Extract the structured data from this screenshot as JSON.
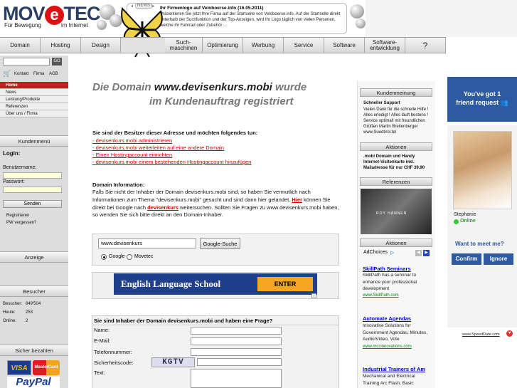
{
  "header": {
    "logo_text_pre": "MOV",
    "logo_text_e": "e",
    "logo_text_post": "TEC",
    "tagline_left": "Für Bewegung",
    "tagline_right": "im Internet",
    "news_label": "NEWS",
    "news_title": "Ihr Firmenlogo auf Veloboerse.info (16.05.2011)",
    "news_body": "Präsentieren Sie jetzt Ihre Firma auf der Startseite von Veloboerse.info. Auf der Startseite direkt unterhalb der Suchfunktion und der Top-Anzeigen. wird Ihr Logo täglich von vielen Personen, welche ihr Fahrrad oder Zubehör ..."
  },
  "nav": {
    "items": [
      "Domain",
      "Hosting",
      "Design",
      "Such-\nmaschinen",
      "Optimierung",
      "Werbung",
      "Service",
      "Software",
      "Software-\nentwicklung",
      "?"
    ]
  },
  "sidebar": {
    "search_button": "GO",
    "links_top": [
      "Kontakt",
      "Firma",
      "AGB"
    ],
    "menu": [
      "Home",
      "News",
      "Leistung/Produkte",
      "Referenzen",
      "Über uns / Firma"
    ],
    "kundenmenu_title": "Kundenmenü",
    "login_label": "Login:",
    "username_label": "Benutzername:",
    "password_label": "Passwort:",
    "send_button": "Senden",
    "register_link": "Registrieren",
    "forgot_link": "PW vergessen?",
    "anzeige_title": "Anzeige",
    "besucher_title": "Besucher",
    "besucher_label": "Besucher:",
    "besucher_value": "849'504",
    "heute_label": "Heute:",
    "heute_value": "253",
    "online_label": "Online:",
    "online_value": "2",
    "payment_title": "Sicher bezahlen",
    "visa": "VISA",
    "mastercard": "MasterCard",
    "paypal": "PayPal"
  },
  "main": {
    "title_pre": "Die Domain ",
    "title_domain": "www.devisenkurs.mobi",
    "title_post": " wurde",
    "title_line2": "im Kundenauftrag registriert",
    "owner_question": "Sie sind der Besitzer dieser Adresse und möchten folgendes tun:",
    "owner_links": [
      "- devisenkurs.mobi administrieren",
      "- devisenkurs.mobi weiterleiten auf eine andere Domain",
      "- Einen Hostingaccount einrichten",
      "- devisenkurs.mobi einem bestehenden Hostingaccount hinzufügen"
    ],
    "info_heading": "Domain Information:",
    "info_line1": "Falls Sie nicht der Inhaber der Domain devisenkurs.mobi sind, so haben Sie vermutlich nach",
    "info_line2": "Informationen zum Thema \"devisenkurs.mobi\" gesucht und sind dann hier gelandet.",
    "info_hier": "Hier",
    "info_line2b": " können Sie",
    "info_line3a": "direkt bei Google nach ",
    "info_keyword": "devisenkurs",
    "info_line3b": " weitersuchen. Sollten Sie Fragen zu www.devisenkurs.mobi haben,",
    "info_line4": "so wenden Sie sich bitte direkt an den Domain-Inhaber.",
    "search_value": "www.devisenkurs",
    "search_button": "Google-Suche",
    "radio_google": "Google",
    "radio_movetec": "Movetec",
    "ad_text": "English Language School",
    "ad_enter": "ENTER",
    "form_title": "Sie sind Inhaber der Domain devisenkurs.mobi und haben eine Frage?",
    "form_labels": [
      "Name:",
      "E-Mail:",
      "Telefonnummer:",
      "Sicherheitscode:",
      "Text:"
    ],
    "captcha": "KGTV"
  },
  "right": {
    "kundenmeinung_title": "Kundenmeinung",
    "kundenmeinung_heading": "Schneller Support",
    "kundenmeinung_body": "Vielen Dank für die schnelle Hilfe ! Alles erledigt ! Alles läuft bestens ! Service optimal! mit freundlichen Grüßen Martin Breitenberger www.Suedtirol.tel",
    "aktionen_title": "Aktionen",
    "aktionen_body": ".mobi Domain und Handy Internet-Visitenkarte inkl. Mailadresse für nur CHF 39.90",
    "referenzen_title": "Referenzen",
    "referenz_name": "ROY HÄNNEN",
    "aktionen2_title": "Aktionen",
    "adchoices": "AdChoices",
    "ads": [
      {
        "title": "SkillPath Seminars",
        "body": "SkillPath has a seminar to enhance your professional development",
        "url": "www.SkillPath.com"
      },
      {
        "title": "Automate Agendas",
        "body": "Innovative Solutions for Government Agendas, Minutes, Audio/Video, Vote",
        "url": "www.mccinnovations.com"
      },
      {
        "title": "Industrial Trainers of Am",
        "body": "Mechanical and Electrical Training Arc Flash, Basic",
        "url": ""
      }
    ]
  },
  "speeddate": {
    "banner_line1": "You've got 1",
    "banner_line2": "friend request",
    "name": "Stephanie",
    "status": "Online",
    "question": "Want to meet me?",
    "confirm": "Confirm",
    "ignore": "Ignore",
    "url": "www.SpeedDate.com"
  },
  "colors": {
    "brand": "#2c3e63",
    "accent": "#d11111",
    "link": "#cc0000",
    "speeddate_blue": "#2d5aa0"
  }
}
